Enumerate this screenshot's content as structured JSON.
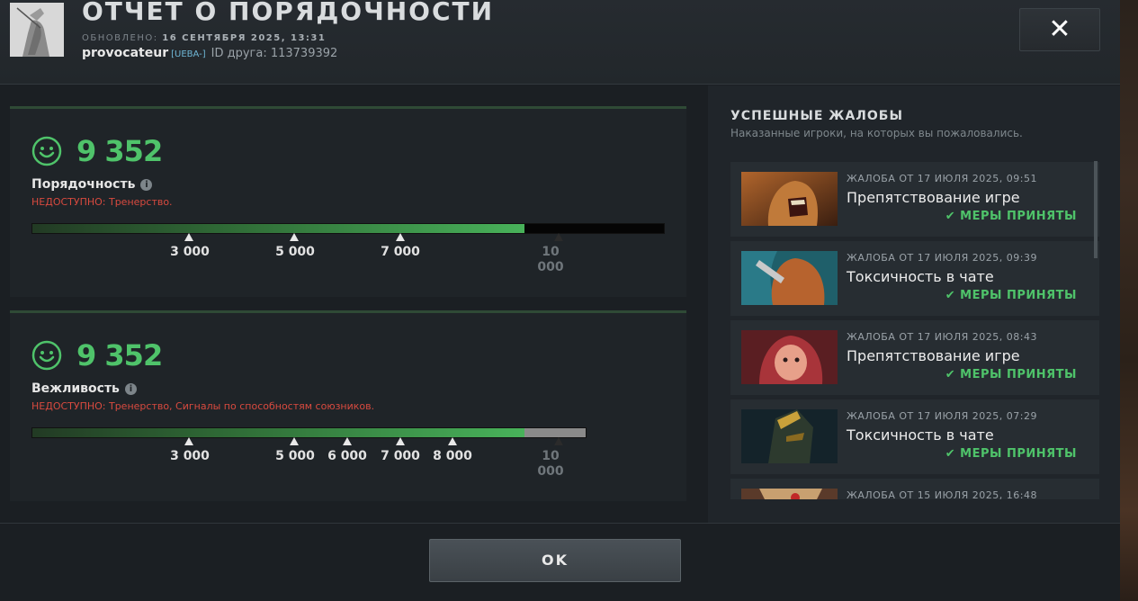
{
  "header": {
    "title": "ОТЧЁТ О ПОРЯДОЧНОСТИ",
    "updated_label": "ОБНОВЛЕНО:",
    "updated_value": "16 СЕНТЯБРЯ 2025, 13:31",
    "player_name": "provocateur",
    "player_tag": "[UEBA-]",
    "friend_id": "ID друга: 113739392",
    "close_label": "✕"
  },
  "conduct": {
    "score": "9 352",
    "label": "Порядочность",
    "unavailable": "НЕДОСТУПНО:  Тренерство.",
    "progress": 0.9352,
    "ticks": [
      "3 000",
      "5 000",
      "7 000"
    ],
    "max_tick": "10 000"
  },
  "politeness": {
    "score": "9 352",
    "label": "Вежливость",
    "unavailable": "НЕДОСТУПНО:  Тренерство, Сигналы по способностям союзников.",
    "progress": 0.9352,
    "ticks": [
      "3 000",
      "5 000",
      "6 000",
      "7 000",
      "8 000"
    ],
    "max_tick": "10 000"
  },
  "reports": {
    "title": "УСПЕШНЫЕ ЖАЛОБЫ",
    "subtitle": "Наказанные игроки, на которых вы пожаловались.",
    "status_text": "МЕРЫ ПРИНЯТЫ",
    "items": [
      {
        "date": "ЖАЛОБА ОТ 17 ИЮЛЯ 2025, 09:51",
        "type": "Препятствование игре",
        "hero_icon": "lifestealer-portrait"
      },
      {
        "date": "ЖАЛОБА ОТ 17 ИЮЛЯ 2025, 09:39",
        "type": "Токсичность в чате",
        "hero_icon": "beastmaster-portrait"
      },
      {
        "date": "ЖАЛОБА ОТ 17 ИЮЛЯ 2025, 08:43",
        "type": "Препятствование игре",
        "hero_icon": "dark-willow-portrait"
      },
      {
        "date": "ЖАЛОБА ОТ 17 ИЮЛЯ 2025, 07:29",
        "type": "Токсичность в чате",
        "hero_icon": "armored-hero-portrait"
      },
      {
        "date": "ЖАЛОБА ОТ 15 ИЮЛЯ 2025, 16:48",
        "type": "",
        "hero_icon": "hero-portrait"
      }
    ]
  },
  "footer": {
    "ok_label": "OK"
  },
  "colors": {
    "accent_green": "#4fc36a",
    "warning_red": "#d84a3f"
  }
}
